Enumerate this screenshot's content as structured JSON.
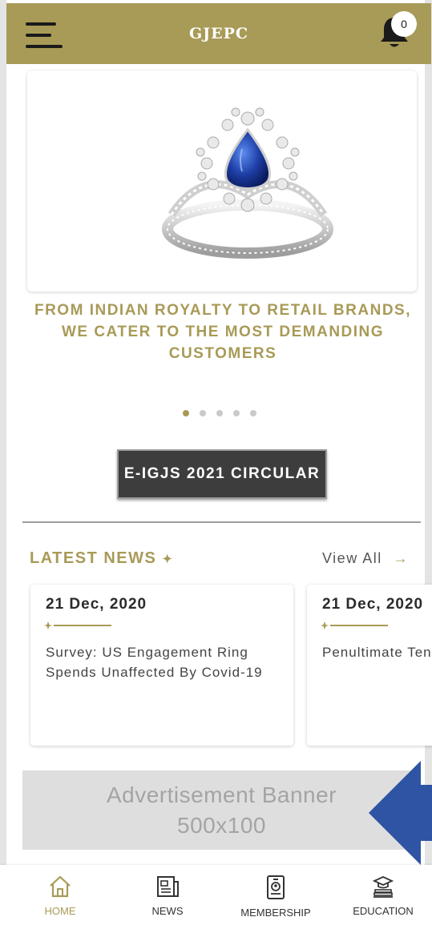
{
  "app_bar": {
    "title": "GJEPC",
    "notification_count": "0",
    "background": "#a89a57"
  },
  "carousel": {
    "caption": "FROM INDIAN ROYALTY TO RETAIL BRANDS, WE CATER TO THE MOST DEMANDING CUSTOMERS",
    "slide_count": 5,
    "active_index": 0
  },
  "circular_button": {
    "label": "E-IGJS 2021 CIRCULAR"
  },
  "latest_news": {
    "heading": "LATEST NEWS",
    "heading_star": "✦",
    "view_all_label": "View All",
    "view_all_arrow": "→",
    "items": [
      {
        "date": "21 Dec, 2020",
        "title": "Survey: US Engagement Ring Spends Unaffected By Covid-19"
      },
      {
        "date": "21 Dec, 2020",
        "title": "Penultimate Tender Break"
      }
    ]
  },
  "ad_banner": {
    "line1": "Advertisement Banner",
    "line2": "500x100"
  },
  "bottom_nav": {
    "items": [
      {
        "label": "HOME",
        "icon": "home-icon",
        "active": true
      },
      {
        "label": "NEWS",
        "icon": "newspaper-icon",
        "active": false
      },
      {
        "label": "MEMBERSHIP",
        "icon": "id-badge-icon",
        "active": false
      },
      {
        "label": "EDUCATION",
        "icon": "graduation-cap-icon",
        "active": false
      }
    ]
  },
  "colors": {
    "accent": "#a89a57",
    "overlay_arrow": "#2e54a3",
    "button": "#3d3d3d"
  }
}
